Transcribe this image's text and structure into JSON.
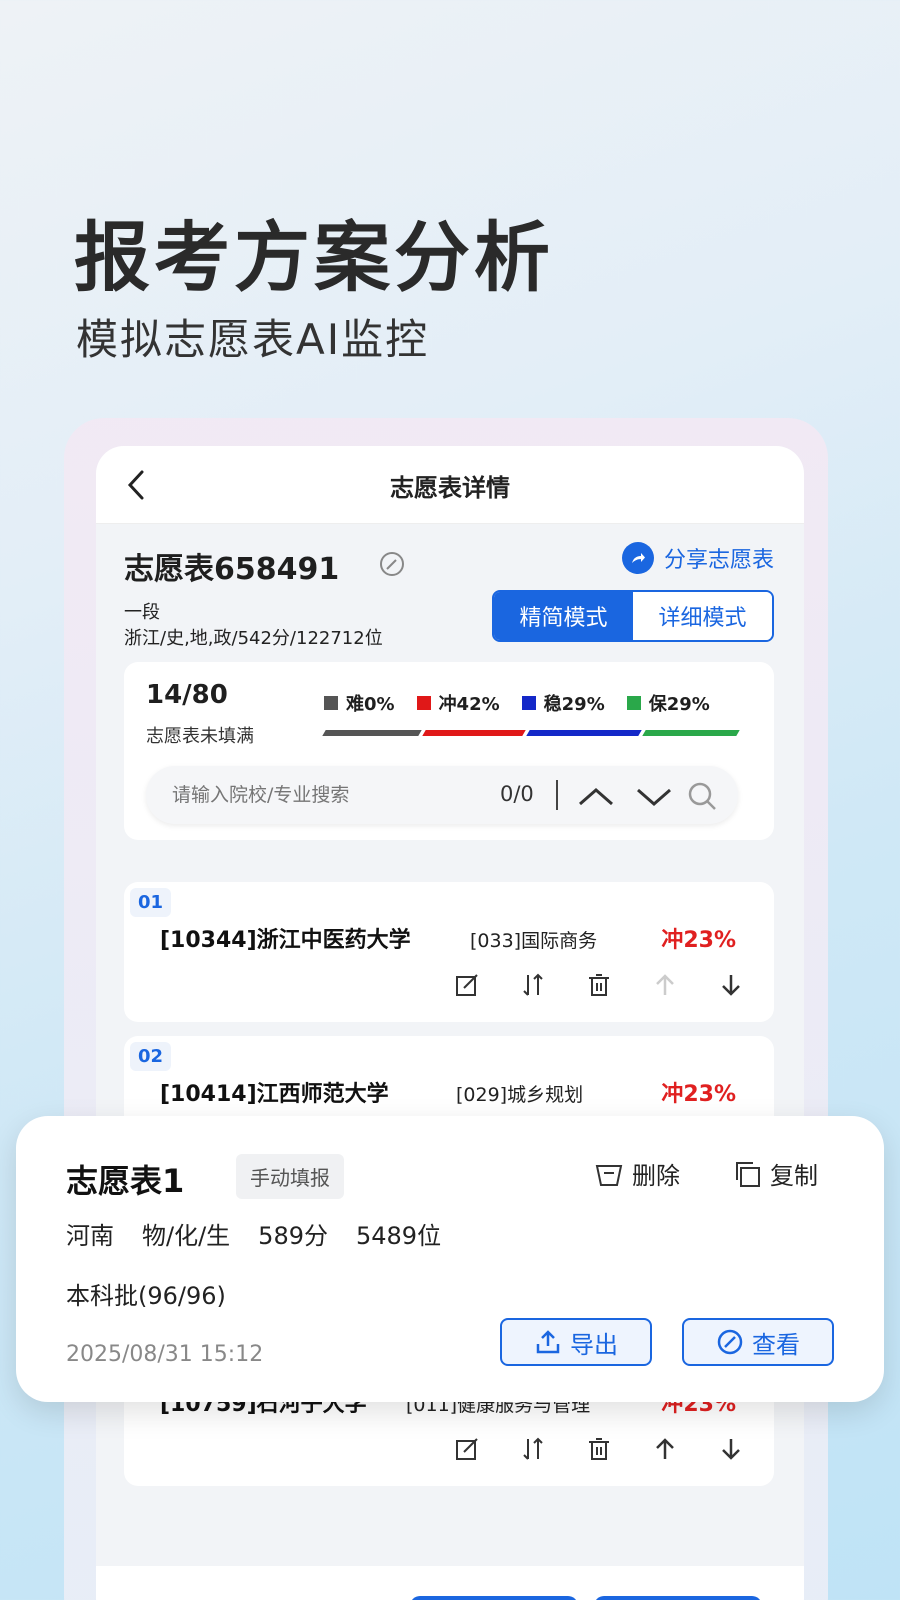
{
  "hero": {
    "title": "报考方案分析",
    "subtitle": "模拟志愿表AI监控"
  },
  "topbar": {
    "title": "志愿表详情"
  },
  "sheet": {
    "name": "志愿表658491",
    "share_label": "分享志愿表",
    "level": "一段",
    "profile": "浙江/史,地,政/542分/122712位",
    "modes": [
      "精简模式",
      "详细模式"
    ],
    "active_mode": "精简模式"
  },
  "stats": {
    "count": "14/80",
    "note": "志愿表未填满",
    "legend": [
      {
        "label": "难0%",
        "color": "#555555",
        "value": 0
      },
      {
        "label": "冲42%",
        "color": "#e01818",
        "value": 42
      },
      {
        "label": "稳29%",
        "color": "#1428c8",
        "value": 29
      },
      {
        "label": "保29%",
        "color": "#2aa84a",
        "value": 29
      }
    ]
  },
  "search": {
    "placeholder": "请输入院校/专业搜索",
    "count": "0/0"
  },
  "items": [
    {
      "num": "01",
      "school": "[10344]浙江中医药大学",
      "major": "[033]国际商务",
      "rate": "冲23%"
    },
    {
      "num": "02",
      "school": "[10414]江西师范大学",
      "major": "[029]城乡规划",
      "rate": "冲23%"
    },
    {
      "num": "",
      "school": "[10759]石河子大学",
      "major": "[011]健康服务与管理",
      "rate": "冲23%"
    }
  ],
  "card": {
    "title": "志愿表1",
    "tag": "手动填报",
    "delete_label": "删除",
    "copy_label": "复制",
    "province": "河南",
    "subjects": "物/化/生",
    "score": "589分",
    "rank": "5489位",
    "batch": "本科批(96/96)",
    "date": "2025/08/31 15:12",
    "export_label": "导出",
    "view_label": "查看"
  }
}
